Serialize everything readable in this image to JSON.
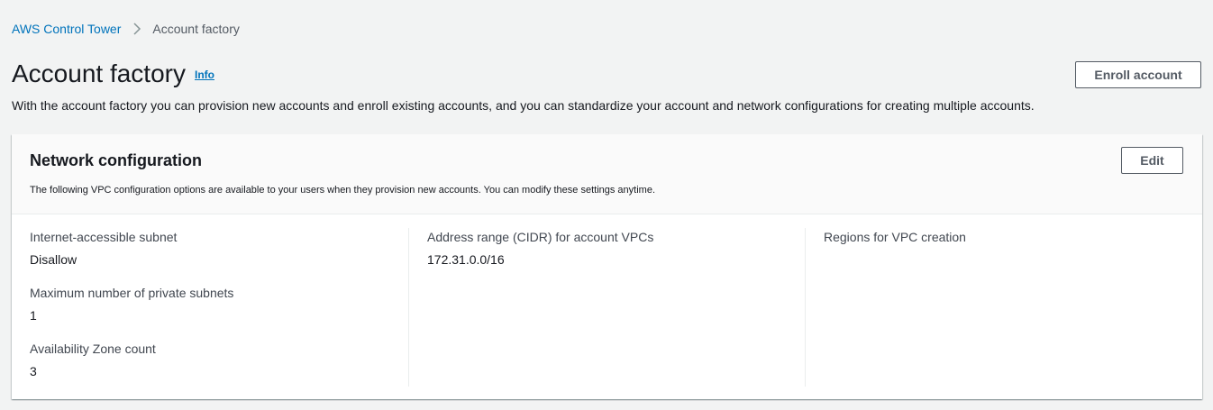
{
  "breadcrumb": {
    "parent": "AWS Control Tower",
    "current": "Account factory"
  },
  "header": {
    "title": "Account factory",
    "info": "Info",
    "description": "With the account factory you can provision new accounts and enroll existing accounts, and you can standardize your account and network configurations for creating multiple accounts.",
    "enroll_button": "Enroll account"
  },
  "network": {
    "title": "Network configuration",
    "description": "The following VPC configuration options are available to your users when they provision new accounts. You can modify these settings anytime.",
    "edit_button": "Edit",
    "column1": [
      {
        "label": "Internet-accessible subnet",
        "value": "Disallow"
      },
      {
        "label": "Maximum number of private subnets",
        "value": "1"
      },
      {
        "label": "Availability Zone count",
        "value": "3"
      }
    ],
    "column2": [
      {
        "label": "Address range (CIDR) for account VPCs",
        "value": "172.31.0.0/16"
      }
    ],
    "column3": [
      {
        "label": "Regions for VPC creation",
        "value": ""
      }
    ]
  },
  "colors": {
    "link": "#0073bb",
    "background": "#f2f3f3",
    "text": "#16191f",
    "button_border": "#545b64"
  }
}
